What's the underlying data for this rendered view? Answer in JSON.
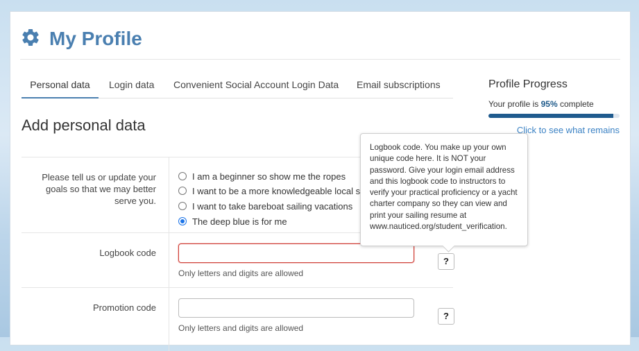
{
  "header": {
    "title": "My Profile",
    "icon": "gear-icon",
    "accent": "#4a7fb0"
  },
  "tabs": [
    {
      "label": "Personal data",
      "active": true
    },
    {
      "label": "Login data"
    },
    {
      "label": "Convenient Social Account Login Data"
    },
    {
      "label": "Email subscriptions"
    }
  ],
  "section": {
    "title": "Add personal data"
  },
  "form": {
    "goals": {
      "label": "Please tell us or update your goals so that we may better serve you.",
      "label_lines": [
        "Please tell us or update your",
        "goals so that we may better",
        "serve you."
      ],
      "options": [
        {
          "label": "I am a beginner so show me the ropes",
          "checked": false
        },
        {
          "label": "I want to be a more knowledgeable local sailor",
          "checked": false
        },
        {
          "label": "I want to take bareboat sailing vacations",
          "checked": false
        },
        {
          "label": "The deep blue is for me",
          "checked": true
        }
      ]
    },
    "logbook": {
      "label": "Logbook code",
      "value": "",
      "placeholder": "",
      "hint": "Only letters and digits are allowed",
      "help": "?",
      "state": "error"
    },
    "promotion": {
      "label": "Promotion code",
      "value": "",
      "placeholder": "",
      "hint": "Only letters and digits are allowed",
      "help": "?"
    }
  },
  "tooltip": {
    "text": "Logbook code. You make up your own unique code here. It is NOT your password. Give your login email address and this logbook code to instructors to verify your practical proficiency or a yacht charter company so they can view and print your sailing resume at www.nauticed.org/student_verification."
  },
  "progress": {
    "title": "Profile Progress",
    "text_prefix": "Your profile is",
    "percent": "95%",
    "percent_value": 95,
    "text_suffix": "complete",
    "link": "Click to see what remains",
    "bar_color": "#1f5b8e"
  }
}
